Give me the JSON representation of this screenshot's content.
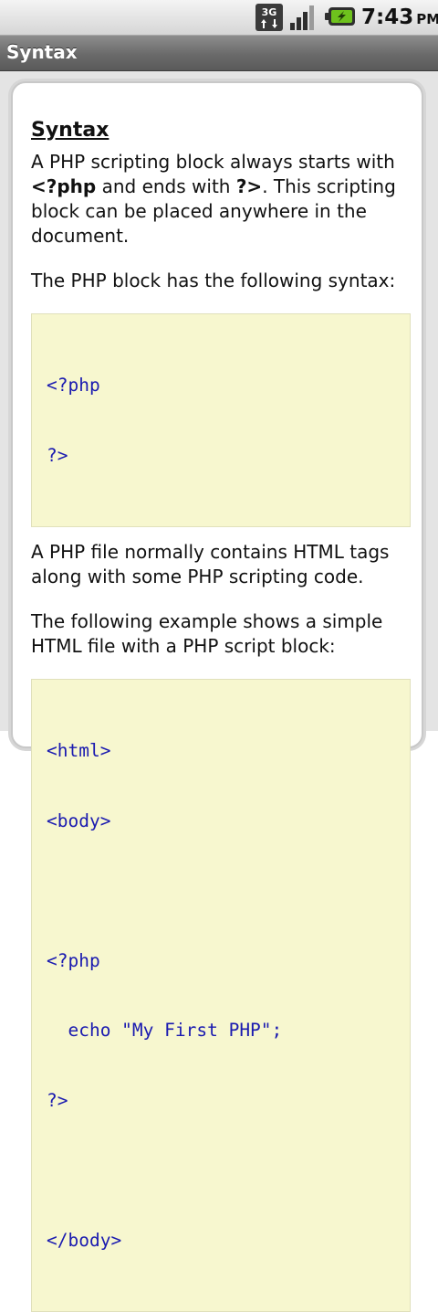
{
  "status_bar": {
    "network": "3G",
    "time": "7:43",
    "ampm": "PM",
    "icons": [
      "3g-data-icon",
      "signal-strength-icon",
      "battery-charging-icon"
    ]
  },
  "title_bar": {
    "title": "Syntax"
  },
  "content": {
    "heading": "Syntax",
    "para1": {
      "t1": "A PHP scripting block always starts with ",
      "b1": "<?php",
      "t2": " and ends with ",
      "b2": "?>",
      "t3": ". This scripting block can be placed anywhere in the document."
    },
    "para2": "The PHP block has the following syntax:",
    "code1": [
      "<?php",
      "?>"
    ],
    "para3": "A PHP file normally contains HTML tags along with some PHP scripting code.",
    "para4": "The following example shows a simple HTML file with a PHP script block:",
    "code2": [
      "<html>",
      "<body>",
      "",
      "<?php",
      "  echo \"My First PHP\";",
      "?>",
      "",
      "</body>"
    ]
  },
  "colors": {
    "code_text": "#1a1ab0",
    "code_background": "#f7f7cf",
    "title_bar": "#6a6a6a"
  }
}
